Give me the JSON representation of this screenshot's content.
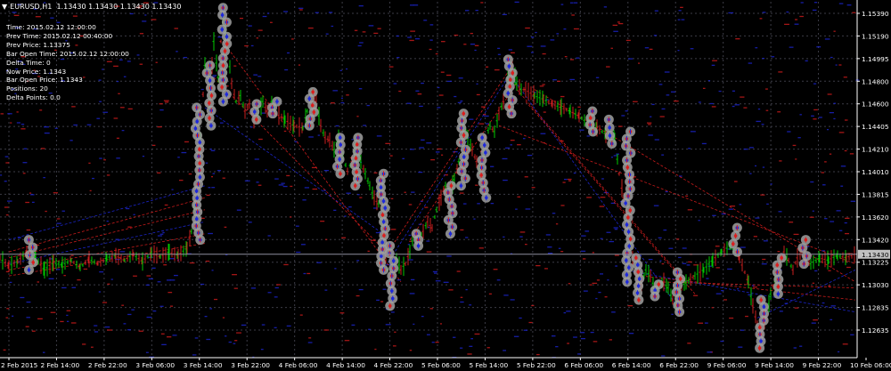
{
  "window": {
    "symbol": "EURUSD,H1",
    "ohlc": "1.13430 1.13430 1.13430 1.13430"
  },
  "info_lines": [
    "Time: 2015.02.12 12:00:00",
    "Prev Time: 2015.02.12 00:40:00",
    "Prev Price: 1.13375",
    "Bar Open Time: 2015.02.12 12:00:00",
    "Delta Time: 0",
    "Now Price: 1.1343",
    "Bar Open Price: 1.1343",
    "Positions: 20",
    "Delta Points: 0.0"
  ],
  "current_price_label": "1.13430",
  "colors": {
    "background": "#000000",
    "grid": "#3c3c46",
    "bull_bar": "#00c800",
    "bear_bar": "#c81e1e",
    "blue_marks": "#1e28dc",
    "red_marks": "#dc1e1e",
    "circle": "#a0a0a0",
    "price_line": "#8e8e9e"
  },
  "chart_data": {
    "type": "candlestick",
    "y_ticks": [
      "1.15390",
      "1.15190",
      "1.14995",
      "1.14800",
      "1.14600",
      "1.14405",
      "1.14210",
      "1.14010",
      "1.13815",
      "1.13620",
      "1.13420",
      "1.13225",
      "1.13030",
      "1.12835",
      "1.12635"
    ],
    "x_ticks": [
      "2 Feb 2015",
      "2 Feb 14:00",
      "2 Feb 22:00",
      "3 Feb 06:00",
      "3 Feb 14:00",
      "3 Feb 22:00",
      "4 Feb 06:00",
      "4 Feb 14:00",
      "4 Feb 22:00",
      "5 Feb 06:00",
      "5 Feb 14:00",
      "5 Feb 22:00",
      "6 Feb 06:00",
      "6 Feb 14:00",
      "6 Feb 22:00",
      "9 Feb 06:00",
      "9 Feb 14:00",
      "9 Feb 22:00",
      "10 Feb 06:00"
    ],
    "ylim": [
      1.1257,
      1.1553
    ],
    "current_price": 1.1343,
    "grid": true,
    "path": [
      [
        0,
        1.134
      ],
      [
        10,
        1.1333
      ],
      [
        20,
        1.1337
      ],
      [
        30,
        1.1345
      ],
      [
        40,
        1.134
      ],
      [
        50,
        1.133
      ],
      [
        60,
        1.1336
      ],
      [
        70,
        1.1334
      ],
      [
        80,
        1.1338
      ],
      [
        90,
        1.1332
      ],
      [
        100,
        1.1339
      ],
      [
        110,
        1.1335
      ],
      [
        120,
        1.134
      ],
      [
        130,
        1.1342
      ],
      [
        140,
        1.1338
      ],
      [
        150,
        1.1343
      ],
      [
        160,
        1.1337
      ],
      [
        170,
        1.1344
      ],
      [
        180,
        1.1341
      ],
      [
        190,
        1.1345
      ],
      [
        200,
        1.1342
      ],
      [
        210,
        1.1348
      ],
      [
        215,
        1.1362
      ],
      [
        220,
        1.1395
      ],
      [
        225,
        1.144
      ],
      [
        230,
        1.15
      ],
      [
        235,
        1.147
      ],
      [
        240,
        1.152
      ],
      [
        245,
        1.149
      ],
      [
        250,
        1.154
      ],
      [
        255,
        1.152
      ],
      [
        260,
        1.1485
      ],
      [
        265,
        1.147
      ],
      [
        270,
        1.1475
      ],
      [
        275,
        1.1462
      ],
      [
        280,
        1.1468
      ],
      [
        285,
        1.1455
      ],
      [
        290,
        1.146
      ],
      [
        295,
        1.147
      ],
      [
        300,
        1.1462
      ],
      [
        305,
        1.147
      ],
      [
        310,
        1.146
      ],
      [
        320,
        1.1455
      ],
      [
        330,
        1.145
      ],
      [
        340,
        1.1448
      ],
      [
        345,
        1.1462
      ],
      [
        350,
        1.1478
      ],
      [
        355,
        1.147
      ],
      [
        360,
        1.145
      ],
      [
        365,
        1.144
      ],
      [
        370,
        1.1438
      ],
      [
        375,
        1.143
      ],
      [
        380,
        1.144
      ],
      [
        385,
        1.1425
      ],
      [
        390,
        1.1412
      ],
      [
        395,
        1.142
      ],
      [
        400,
        1.1435
      ],
      [
        405,
        1.142
      ],
      [
        410,
        1.141
      ],
      [
        415,
        1.14
      ],
      [
        420,
        1.139
      ],
      [
        425,
        1.1385
      ],
      [
        430,
        1.136
      ],
      [
        435,
        1.133
      ],
      [
        440,
        1.132
      ],
      [
        445,
        1.134
      ],
      [
        450,
        1.133
      ],
      [
        455,
        1.1335
      ],
      [
        460,
        1.1345
      ],
      [
        465,
        1.136
      ],
      [
        470,
        1.1355
      ],
      [
        475,
        1.1362
      ],
      [
        480,
        1.137
      ],
      [
        485,
        1.1365
      ],
      [
        490,
        1.138
      ],
      [
        495,
        1.139
      ],
      [
        500,
        1.14
      ],
      [
        505,
        1.1395
      ],
      [
        510,
        1.1405
      ],
      [
        515,
        1.142
      ],
      [
        520,
        1.145
      ],
      [
        525,
        1.144
      ],
      [
        530,
        1.143
      ],
      [
        535,
        1.142
      ],
      [
        540,
        1.141
      ],
      [
        545,
        1.144
      ],
      [
        550,
        1.145
      ],
      [
        555,
        1.1445
      ],
      [
        560,
        1.146
      ],
      [
        565,
        1.147
      ],
      [
        570,
        1.149
      ],
      [
        575,
        1.15
      ],
      [
        580,
        1.1485
      ],
      [
        585,
        1.148
      ],
      [
        590,
        1.148
      ],
      [
        600,
        1.1475
      ],
      [
        610,
        1.1472
      ],
      [
        620,
        1.1468
      ],
      [
        630,
        1.1465
      ],
      [
        640,
        1.1462
      ],
      [
        650,
        1.1458
      ],
      [
        660,
        1.1452
      ],
      [
        670,
        1.1448
      ],
      [
        680,
        1.1443
      ],
      [
        690,
        1.144
      ],
      [
        695,
        1.141
      ],
      [
        700,
        1.139
      ],
      [
        705,
        1.137
      ],
      [
        710,
        1.134
      ],
      [
        715,
        1.132
      ],
      [
        720,
        1.1318
      ],
      [
        725,
        1.133
      ],
      [
        730,
        1.1325
      ],
      [
        735,
        1.1315
      ],
      [
        740,
        1.1318
      ],
      [
        745,
        1.132
      ],
      [
        750,
        1.1315
      ],
      [
        755,
        1.1305
      ],
      [
        760,
        1.13
      ],
      [
        765,
        1.1315
      ],
      [
        770,
        1.132
      ],
      [
        775,
        1.1322
      ],
      [
        780,
        1.1325
      ],
      [
        790,
        1.133
      ],
      [
        800,
        1.1338
      ],
      [
        810,
        1.1345
      ],
      [
        820,
        1.135
      ],
      [
        830,
        1.134
      ],
      [
        840,
        1.132
      ],
      [
        845,
        1.13
      ],
      [
        850,
        1.1285
      ],
      [
        855,
        1.1275
      ],
      [
        860,
        1.129
      ],
      [
        865,
        1.131
      ],
      [
        870,
        1.132
      ],
      [
        875,
        1.1335
      ],
      [
        880,
        1.1345
      ],
      [
        885,
        1.1338
      ],
      [
        890,
        1.133
      ],
      [
        895,
        1.134
      ],
      [
        900,
        1.1345
      ],
      [
        905,
        1.1338
      ],
      [
        910,
        1.1335
      ],
      [
        920,
        1.134
      ],
      [
        930,
        1.1338
      ],
      [
        940,
        1.1342
      ],
      [
        950,
        1.134
      ],
      [
        960,
        1.1343
      ]
    ],
    "circle_clusters": [
      [
        35,
        1.133,
        1.1355
      ],
      [
        222,
        1.1355,
        1.1465
      ],
      [
        235,
        1.145,
        1.15
      ],
      [
        252,
        1.147,
        1.1548
      ],
      [
        288,
        1.1455,
        1.1468
      ],
      [
        308,
        1.146,
        1.147
      ],
      [
        350,
        1.145,
        1.1478
      ],
      [
        380,
        1.141,
        1.144
      ],
      [
        400,
        1.14,
        1.144
      ],
      [
        430,
        1.133,
        1.141
      ],
      [
        440,
        1.13,
        1.135
      ],
      [
        468,
        1.135,
        1.136
      ],
      [
        505,
        1.136,
        1.14
      ],
      [
        520,
        1.14,
        1.146
      ],
      [
        543,
        1.139,
        1.144
      ],
      [
        573,
        1.146,
        1.1505
      ],
      [
        665,
        1.1445,
        1.1462
      ],
      [
        685,
        1.1435,
        1.1455
      ],
      [
        705,
        1.132,
        1.1445
      ],
      [
        715,
        1.1305,
        1.134
      ],
      [
        737,
        1.1308,
        1.1318
      ],
      [
        762,
        1.1295,
        1.1328
      ],
      [
        825,
        1.1345,
        1.1365
      ],
      [
        855,
        1.1265,
        1.1305
      ],
      [
        875,
        1.131,
        1.134
      ],
      [
        903,
        1.1335,
        1.1355
      ]
    ],
    "fan_lines": [
      [
        [
          10,
          1.1355
        ],
        [
          230,
          1.14
        ]
      ],
      [
        [
          10,
          1.1345
        ],
        [
          230,
          1.139
        ]
      ],
      [
        [
          10,
          1.134
        ],
        [
          230,
          1.138
        ]
      ],
      [
        [
          10,
          1.1335
        ],
        [
          230,
          1.137
        ]
      ],
      [
        [
          10,
          1.133
        ],
        [
          230,
          1.136
        ]
      ],
      [
        [
          10,
          1.1325
        ],
        [
          230,
          1.1352
        ]
      ],
      [
        [
          230,
          1.1465
        ],
        [
          430,
          1.136
        ]
      ],
      [
        [
          240,
          1.149
        ],
        [
          440,
          1.134
        ]
      ],
      [
        [
          250,
          1.152
        ],
        [
          450,
          1.132
        ]
      ],
      [
        [
          430,
          1.133
        ],
        [
          570,
          1.149
        ]
      ],
      [
        [
          440,
          1.135
        ],
        [
          575,
          1.15
        ]
      ],
      [
        [
          460,
          1.1355
        ],
        [
          580,
          1.1485
        ]
      ],
      [
        [
          575,
          1.149
        ],
        [
          760,
          1.13
        ]
      ],
      [
        [
          580,
          1.148
        ],
        [
          770,
          1.132
        ]
      ],
      [
        [
          590,
          1.147
        ],
        [
          780,
          1.131
        ]
      ],
      [
        [
          700,
          1.133
        ],
        [
          960,
          1.1295
        ]
      ],
      [
        [
          720,
          1.1325
        ],
        [
          960,
          1.1305
        ]
      ],
      [
        [
          740,
          1.132
        ],
        [
          960,
          1.1315
        ]
      ],
      [
        [
          850,
          1.129
        ],
        [
          960,
          1.133
        ]
      ],
      [
        [
          600,
          1.148
        ],
        [
          960,
          1.132
        ]
      ],
      [
        [
          560,
          1.145
        ],
        [
          960,
          1.1335
        ]
      ]
    ]
  }
}
